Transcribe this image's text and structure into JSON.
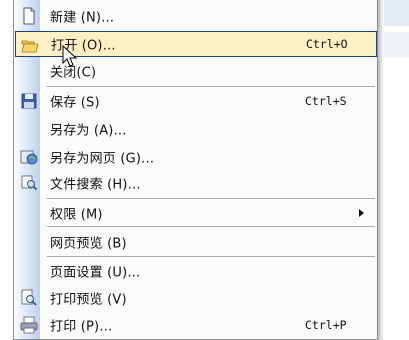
{
  "menu": {
    "items": [
      {
        "label": "新建 (N)...",
        "shortcut": "",
        "icon": "new-document-icon"
      },
      {
        "label": "打开 (O)...",
        "shortcut": "Ctrl+O",
        "icon": "open-folder-icon",
        "highlighted": true
      },
      {
        "label": "关闭(C)",
        "shortcut": "",
        "icon": ""
      },
      {
        "label": "保存 (S)",
        "shortcut": "Ctrl+S",
        "icon": "save-floppy-icon"
      },
      {
        "label": "另存为 (A)...",
        "shortcut": "",
        "icon": ""
      },
      {
        "label": "另存为网页 (G)...",
        "shortcut": "",
        "icon": "web-page-icon"
      },
      {
        "label": "文件搜索 (H)...",
        "shortcut": "",
        "icon": "file-search-icon"
      },
      {
        "label": "权限 (M)",
        "shortcut": "",
        "icon": "",
        "submenu": true
      },
      {
        "label": "网页预览 (B)",
        "shortcut": "",
        "icon": ""
      },
      {
        "label": "页面设置 (U)...",
        "shortcut": "",
        "icon": ""
      },
      {
        "label": "打印预览 (V)",
        "shortcut": "",
        "icon": "print-preview-icon"
      },
      {
        "label": "打印 (P)...",
        "shortcut": "Ctrl+P",
        "icon": "print-icon"
      }
    ]
  },
  "colors": {
    "highlight_fill": "#fff0c4",
    "highlight_border": "#1a3d8f",
    "menu_background": "#fbfbf9",
    "gutter_blue": "#d7e3f5"
  }
}
